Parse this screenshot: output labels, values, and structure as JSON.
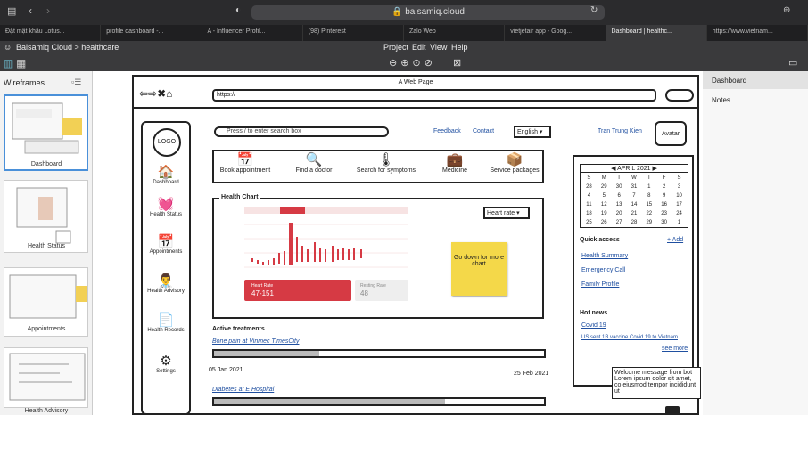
{
  "browser": {
    "url": "balsamiq.cloud",
    "tabs": [
      "Đặt mật khẩu Lotus...",
      "profile dashboard -...",
      "A - Influencer Profil...",
      "(98) Pinterest",
      "Zalo Web",
      "vietjetair app - Goog...",
      "Dashboard | healthc...",
      "https://www.vietnam..."
    ]
  },
  "app": {
    "breadcrumb": "Balsamiq Cloud > healthcare",
    "menu": [
      "Project",
      "Edit",
      "View",
      "Help"
    ]
  },
  "sidebar": {
    "title": "Wireframes",
    "items": [
      "Dashboard",
      "Health Status",
      "Appointments",
      "Health Advisory"
    ]
  },
  "rightpanel": {
    "tabs": [
      "Dashboard",
      "Notes"
    ]
  },
  "mock": {
    "page_title": "A Web Page",
    "url": "https://",
    "logo": "LOGO",
    "search_placeholder": "Press / to enter search box",
    "links": [
      "Feedback",
      "Contact"
    ],
    "language": "English",
    "user": "Tran Trung Kien",
    "avatar": "Avatar",
    "nav": [
      {
        "label": "Dashboard",
        "icon": "🏠"
      },
      {
        "label": "Health Status",
        "icon": "💓"
      },
      {
        "label": "Appointments",
        "icon": "📅"
      },
      {
        "label": "Health Advisory",
        "icon": "👨‍⚕"
      },
      {
        "label": "Health Records",
        "icon": "📄"
      },
      {
        "label": "Settings",
        "icon": "⚙"
      }
    ],
    "quick": [
      {
        "label": "Book appointment",
        "icon": "📅"
      },
      {
        "label": "Find a doctor",
        "icon": "🔍"
      },
      {
        "label": "Search for symptoms",
        "icon": "🌡"
      },
      {
        "label": "Medicine",
        "icon": "💼"
      },
      {
        "label": "Service packages",
        "icon": "📦"
      }
    ],
    "chart": {
      "title": "Health Chart",
      "select": "Heart rate",
      "sticky": "Go down for more chart",
      "card1_label": "Heart Rate",
      "card1_value": "47-151",
      "card2_label": "Resting Rate",
      "card2_value": "48"
    },
    "treatments": {
      "title": "Active treatments",
      "items": [
        {
          "name": "Bone pain at Vinmec TimesCity",
          "start": "05 Jan 2021",
          "end": "25 Feb 2021",
          "progress": 0.32
        },
        {
          "name": "Diabetes at E Hospital",
          "progress": 0.7
        }
      ]
    },
    "calendar": {
      "month": "APRIL 2021",
      "days": [
        "S",
        "M",
        "T",
        "W",
        "T",
        "F",
        "S"
      ],
      "weeks": [
        [
          "28",
          "29",
          "30",
          "31",
          "1",
          "2",
          "3"
        ],
        [
          "4",
          "5",
          "6",
          "7",
          "8",
          "9",
          "10"
        ],
        [
          "11",
          "12",
          "13",
          "14",
          "15",
          "16",
          "17"
        ],
        [
          "18",
          "19",
          "20",
          "21",
          "22",
          "23",
          "24"
        ],
        [
          "25",
          "26",
          "27",
          "28",
          "29",
          "30",
          "1"
        ]
      ]
    },
    "quick_access": {
      "title": "Quick access",
      "add": "+ Add",
      "items": [
        "Health Summary",
        "Emergency Call",
        "Family Profile"
      ]
    },
    "news": {
      "title": "Hot news",
      "items": [
        "Covid 19",
        "US sent 1B vaccine Covid 19 to Vietnam"
      ],
      "more": "see more"
    },
    "bot": "Welcome message from bot Lorem ipsum dolor sit amet, co eiusmod tempor incididunt ut l"
  },
  "colors": {
    "accent": "#d63a44",
    "sticky": "#f4d849"
  }
}
